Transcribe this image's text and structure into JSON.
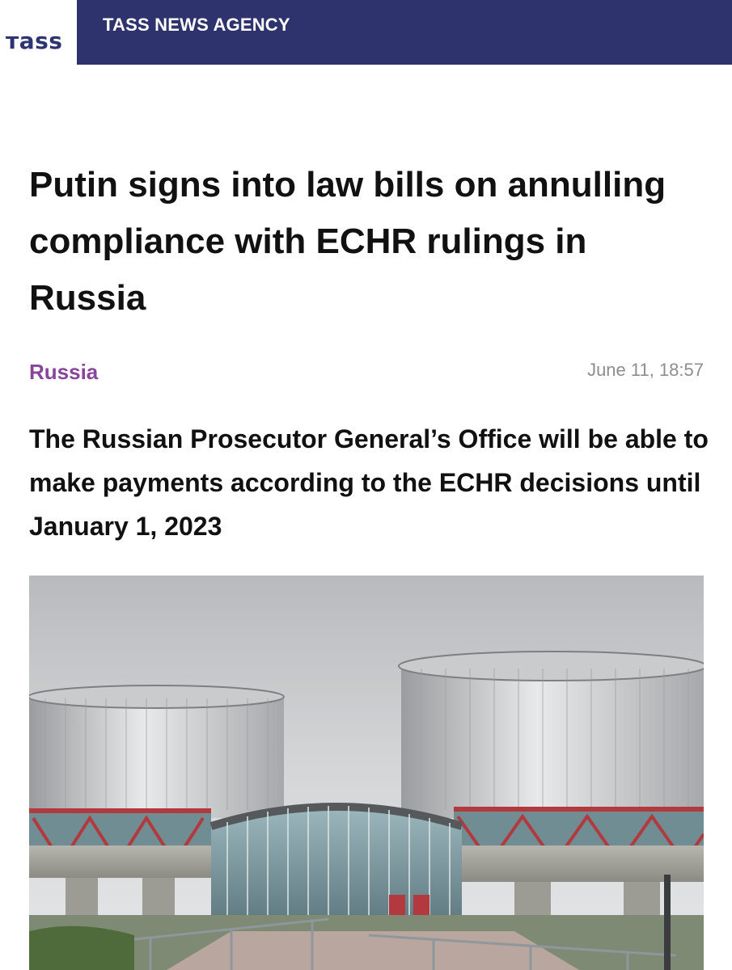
{
  "header": {
    "logo_text": "тass",
    "brand_title": "TASS NEWS AGENCY",
    "brand_color": "#2e336d"
  },
  "article": {
    "headline": "Putin signs into law bills on annulling compliance with ECHR rulings in Russia",
    "category": "Russia",
    "category_color": "#87469b",
    "timestamp": "June 11, 18:57",
    "lede": "The Russian Prosecutor General’s Office will be able to make payments according to the ECHR decisions until January 1, 2023"
  },
  "image": {
    "subject": "building-photo"
  }
}
